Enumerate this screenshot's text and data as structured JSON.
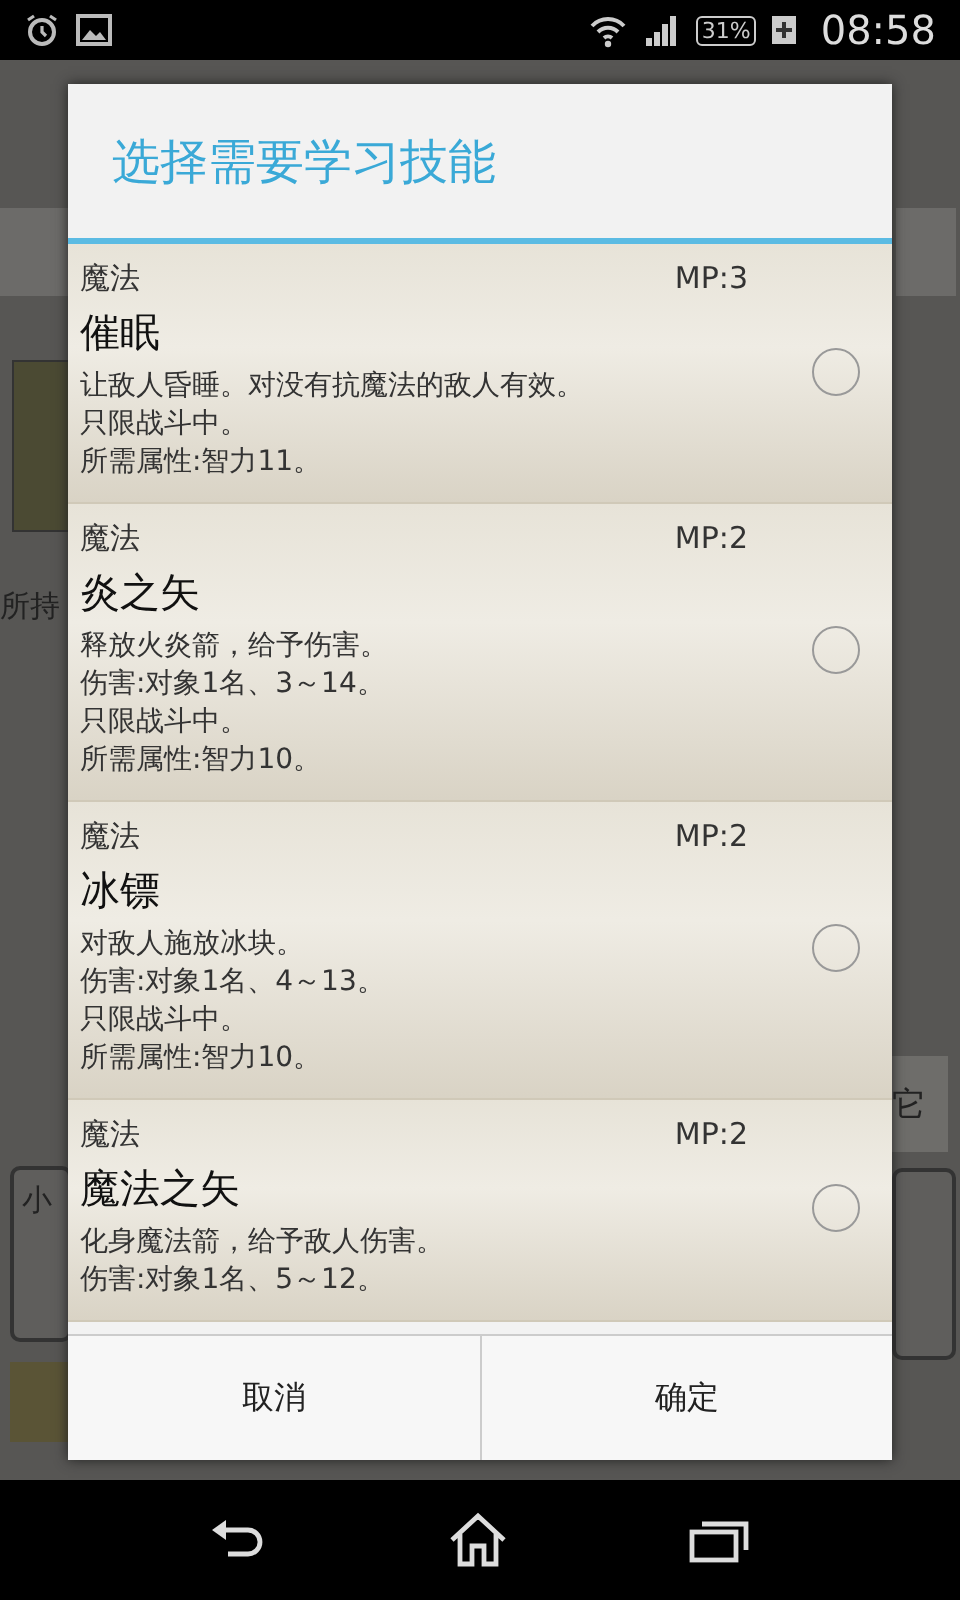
{
  "status_bar": {
    "time": "08:58",
    "battery": "31%"
  },
  "background": {
    "left_label": "所持",
    "left_box_text": "小",
    "right_button_text": "它"
  },
  "dialog": {
    "title": "选择需要学习技能",
    "skills": [
      {
        "category": "魔法",
        "mp": "MP:3",
        "name": "催眠",
        "lines": [
          "让敌人昏睡。对没有抗魔法的敌人有效。",
          "只限战斗中。",
          "所需属性:智力11。"
        ],
        "selected": false
      },
      {
        "category": "魔法",
        "mp": "MP:2",
        "name": "炎之矢",
        "lines": [
          "释放火炎箭，给予伤害。",
          "伤害:对象1名、3～14。",
          "只限战斗中。",
          "所需属性:智力10。"
        ],
        "selected": false
      },
      {
        "category": "魔法",
        "mp": "MP:2",
        "name": "冰镖",
        "lines": [
          "对敌人施放冰块。",
          "伤害:对象1名、4～13。",
          "只限战斗中。",
          "所需属性:智力10。"
        ],
        "selected": false
      },
      {
        "category": "魔法",
        "mp": "MP:2",
        "name": "魔法之矢",
        "lines": [
          "化身魔法箭，给予敌人伤害。",
          "伤害:对象1名、5～12。"
        ],
        "selected": false
      }
    ],
    "buttons": [
      "取消",
      "确定"
    ]
  }
}
